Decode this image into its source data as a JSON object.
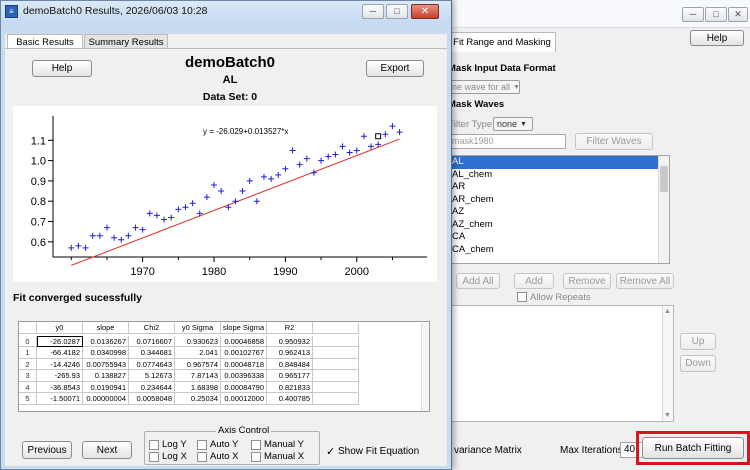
{
  "bg_window": {
    "help_label": "Help",
    "tab_label": "Fit Range and Masking",
    "mask_input_heading": "Mask Input Data Format",
    "wave_format_value": "ne wave for all",
    "mask_waves_heading": "Mask Waves",
    "filter_type_label": "Filter Type",
    "filter_type_value": "none",
    "filter_input_placeholder": "mask1980",
    "filter_waves_label": "Filter Waves",
    "waves": [
      "AL",
      "AL_chem",
      "AR",
      "AR_chem",
      "AZ",
      "AZ_chem",
      "CA",
      "CA_chem"
    ],
    "add_all_label": "Add All",
    "add_label": "Add",
    "remove_label": "Remove",
    "remove_all_label": "Remove All",
    "allow_repeats_label": "Allow Repeats",
    "up_label": "Up",
    "down_label": "Down",
    "covariance_label": "variance Matrix",
    "max_iterations_label": "Max Iterations",
    "max_iterations_value": "40",
    "run_batch_label": "Run Batch Fitting"
  },
  "window": {
    "title": "demoBatch0 Results, 2026/06/03 10:28",
    "tabs": [
      {
        "label": "Basic Results",
        "active": true
      },
      {
        "label": "Summary Results",
        "active": false
      }
    ],
    "help_label": "Help",
    "export_label": "Export",
    "batch_name": "demoBatch0",
    "wave_name": "AL",
    "dataset_label": "Data Set: 0",
    "fit_status": "Fit converged sucessfully",
    "previous_label": "Previous",
    "next_label": "Next",
    "log_y_label": "Log Y",
    "log_x_label": "Log X",
    "axis_control_label": "Axis Control",
    "auto_y_label": "Auto Y",
    "auto_x_label": "Auto X",
    "manual_y_label": "Manual Y",
    "manual_x_label": "Manual X",
    "show_fit_label": "Show Fit Equation",
    "show_fit_checked": true
  },
  "table": {
    "columns": [
      "y0",
      "slope",
      "Chi2",
      "y0 Sigma",
      "slope Sigma",
      "R2"
    ],
    "rows": [
      {
        "idx": "0",
        "cells": [
          "-26.0287",
          "0.0136267",
          "0.0716607",
          "0.930623",
          "0.00046858",
          "0.950932"
        ]
      },
      {
        "idx": "1",
        "cells": [
          "-66.4182",
          "0.0340998",
          "0.344681",
          "2.041",
          "0.00102767",
          "0.962413"
        ]
      },
      {
        "idx": "2",
        "cells": [
          "-14.4246",
          "0.00755943",
          "0.0774643",
          "0.967574",
          "0.00048718",
          "0.848484"
        ]
      },
      {
        "idx": "3",
        "cells": [
          "-265.93",
          "0.138827",
          "5.12673",
          "7.87143",
          "0.00396338",
          "0.965177"
        ]
      },
      {
        "idx": "4",
        "cells": [
          "-36.8543",
          "0.0190941",
          "0.234644",
          "1.68398",
          "0.00084790",
          "0.821833"
        ]
      },
      {
        "idx": "5",
        "cells": [
          "-1.50071",
          "0.00000004",
          "0.0058048",
          "0.25034",
          "0.00012000",
          "0.400785"
        ]
      }
    ]
  },
  "chart_data": {
    "type": "scatter",
    "equation": "y = -26.029+0.013527*x",
    "fit": {
      "intercept": -26.029,
      "slope": 0.013527
    },
    "xlim": [
      1958,
      2009
    ],
    "ylim": [
      0.54,
      1.2
    ],
    "x_ticks": [
      1970,
      1980,
      1990,
      2000
    ],
    "y_ticks": [
      0.6,
      0.7,
      0.8,
      0.9,
      1.0,
      1.1
    ],
    "y_tick_labels": [
      "0.6",
      "0.7",
      "0.8",
      "0.9",
      "1.0",
      "1.1"
    ],
    "marker_color": "#1f1fd8",
    "fit_color": "#e0342c",
    "points": [
      [
        1960,
        0.57
      ],
      [
        1961,
        0.58
      ],
      [
        1962,
        0.57
      ],
      [
        1963,
        0.63
      ],
      [
        1964,
        0.63
      ],
      [
        1965,
        0.67
      ],
      [
        1966,
        0.62
      ],
      [
        1967,
        0.61
      ],
      [
        1968,
        0.63
      ],
      [
        1969,
        0.67
      ],
      [
        1970,
        0.66
      ],
      [
        1971,
        0.74
      ],
      [
        1972,
        0.73
      ],
      [
        1973,
        0.71
      ],
      [
        1974,
        0.72
      ],
      [
        1975,
        0.76
      ],
      [
        1976,
        0.77
      ],
      [
        1977,
        0.79
      ],
      [
        1978,
        0.74
      ],
      [
        1979,
        0.82
      ],
      [
        1980,
        0.88
      ],
      [
        1981,
        0.85
      ],
      [
        1982,
        0.77
      ],
      [
        1983,
        0.8
      ],
      [
        1984,
        0.85
      ],
      [
        1985,
        0.9
      ],
      [
        1986,
        0.8
      ],
      [
        1987,
        0.92
      ],
      [
        1988,
        0.91
      ],
      [
        1989,
        0.93
      ],
      [
        1990,
        0.96
      ],
      [
        1991,
        1.05
      ],
      [
        1992,
        0.98
      ],
      [
        1993,
        1.01
      ],
      [
        1994,
        0.94
      ],
      [
        1995,
        1.0
      ],
      [
        1996,
        1.02
      ],
      [
        1997,
        1.03
      ],
      [
        1998,
        1.07
      ],
      [
        1999,
        1.04
      ],
      [
        2000,
        1.05
      ],
      [
        2001,
        1.12
      ],
      [
        2002,
        1.07
      ],
      [
        2003,
        1.08
      ],
      [
        2004,
        1.13
      ],
      [
        2005,
        1.17
      ],
      [
        2006,
        1.14
      ]
    ],
    "highlight_point": [
      2003,
      1.12
    ]
  }
}
